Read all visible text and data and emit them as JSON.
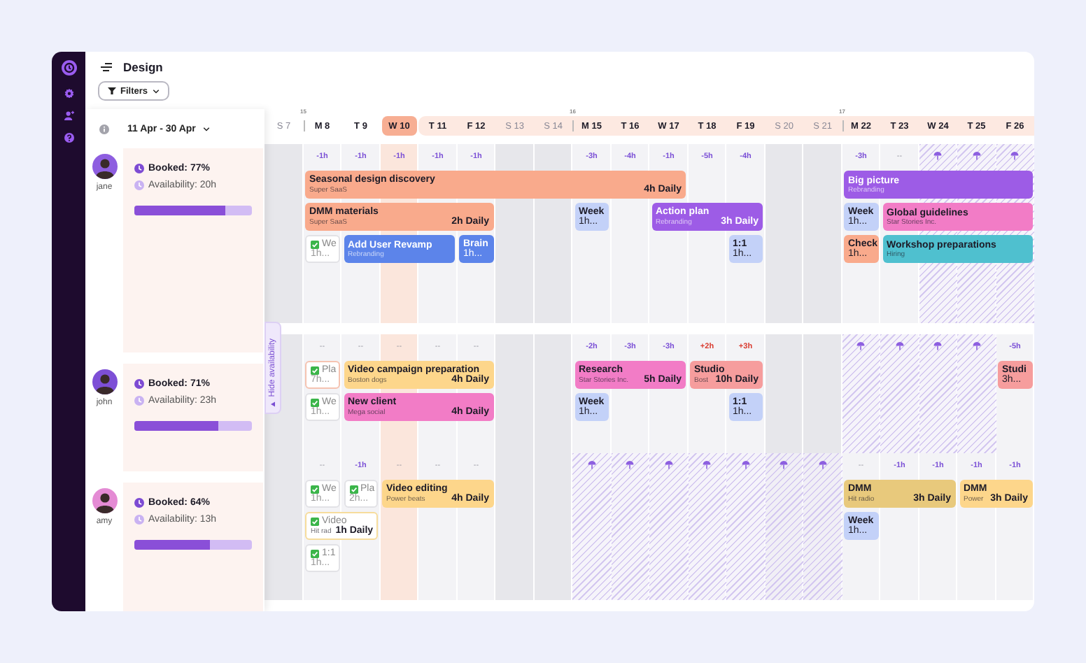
{
  "title": "Design",
  "filters": {
    "label": "Filters"
  },
  "date_range": "11 Apr - 30 Apr",
  "hide_availability": "Hide availability",
  "days": [
    {
      "label": "S 7",
      "weekend": true,
      "today": false,
      "in_range": false
    },
    {
      "label": "M 8",
      "weekend": false,
      "today": false,
      "in_range": false,
      "week": "15"
    },
    {
      "label": "T 9",
      "weekend": false,
      "today": false,
      "in_range": false
    },
    {
      "label": "W 10",
      "weekend": false,
      "today": true,
      "in_range": false
    },
    {
      "label": "T 11",
      "weekend": false,
      "today": false,
      "in_range": true
    },
    {
      "label": "F 12",
      "weekend": false,
      "today": false,
      "in_range": true
    },
    {
      "label": "S 13",
      "weekend": true,
      "today": false,
      "in_range": true
    },
    {
      "label": "S 14",
      "weekend": true,
      "today": false,
      "in_range": true
    },
    {
      "label": "M 15",
      "weekend": false,
      "today": false,
      "in_range": true,
      "week": "16"
    },
    {
      "label": "T 16",
      "weekend": false,
      "today": false,
      "in_range": true
    },
    {
      "label": "W 17",
      "weekend": false,
      "today": false,
      "in_range": true
    },
    {
      "label": "T 18",
      "weekend": false,
      "today": false,
      "in_range": true
    },
    {
      "label": "F 19",
      "weekend": false,
      "today": false,
      "in_range": true
    },
    {
      "label": "S 20",
      "weekend": true,
      "today": false,
      "in_range": true
    },
    {
      "label": "S 21",
      "weekend": true,
      "today": false,
      "in_range": true
    },
    {
      "label": "M 22",
      "weekend": false,
      "today": false,
      "in_range": true,
      "week": "17"
    },
    {
      "label": "T 23",
      "weekend": false,
      "today": false,
      "in_range": true
    },
    {
      "label": "W 24",
      "weekend": false,
      "today": false,
      "in_range": true
    },
    {
      "label": "T 25",
      "weekend": false,
      "today": false,
      "in_range": true
    },
    {
      "label": "F 26",
      "weekend": false,
      "today": false,
      "in_range": true
    }
  ],
  "people": [
    {
      "name": "jane",
      "booked": "Booked: 77%",
      "availability": "Availability: 20h",
      "level": 0.77,
      "cells": [
        {
          "kind": "blank"
        },
        {
          "kind": "under",
          "label": "-1h"
        },
        {
          "kind": "under",
          "label": "-1h"
        },
        {
          "kind": "under",
          "label": "-1h"
        },
        {
          "kind": "under",
          "label": "-1h"
        },
        {
          "kind": "under",
          "label": "-1h"
        },
        {
          "kind": "blank"
        },
        {
          "kind": "blank"
        },
        {
          "kind": "under",
          "label": "-3h"
        },
        {
          "kind": "under",
          "label": "-4h"
        },
        {
          "kind": "under",
          "label": "-1h"
        },
        {
          "kind": "under",
          "label": "-5h"
        },
        {
          "kind": "under",
          "label": "-4h"
        },
        {
          "kind": "blank"
        },
        {
          "kind": "blank"
        },
        {
          "kind": "under",
          "label": "-3h"
        },
        {
          "kind": "empty",
          "label": "--"
        },
        {
          "kind": "holiday"
        },
        {
          "kind": "holiday"
        },
        {
          "kind": "holiday"
        }
      ],
      "events": [
        {
          "kind": "event",
          "title": "Seasonal design discovery",
          "subtitle": "Super SaaS",
          "hours": "4h Daily",
          "color": "#f9aa8c"
        },
        {
          "kind": "event",
          "title": "Big picture",
          "subtitle": "Rebranding",
          "color": "#9d5ce6"
        },
        {
          "kind": "event",
          "title": "DMM materials",
          "subtitle": "Super SaaS",
          "hours": "2h Daily",
          "color": "#f9aa8c"
        },
        {
          "kind": "event",
          "title": "Week",
          "detail": "1h...",
          "color": "#c3d1f8"
        },
        {
          "kind": "event",
          "title": "Action plan",
          "subtitle": "Rebranding",
          "hours": "3h Daily",
          "color": "#9d5ce6"
        },
        {
          "kind": "event",
          "title": "Week",
          "detail": "1h...",
          "color": "#c3d1f8"
        },
        {
          "kind": "event",
          "title": "Global guidelines",
          "subtitle": "Star Stories Inc.",
          "color": "#f27cc6"
        },
        {
          "kind": "task",
          "title": "We",
          "detail": "1h...",
          "color": "#e2e2e6"
        },
        {
          "kind": "event",
          "title": "Add User Revamp",
          "subtitle": "Rebranding",
          "color": "#5c84ea"
        },
        {
          "kind": "event",
          "title": "Brain",
          "detail": "1h...",
          "color": "#5c84ea"
        },
        {
          "kind": "event",
          "title": "1:1",
          "detail": "1h...",
          "color": "#c3d1f8"
        },
        {
          "kind": "event",
          "title": "Check",
          "detail": "1h...",
          "color": "#f9aa8c"
        },
        {
          "kind": "event",
          "title": "Workshop preparations",
          "subtitle": "Hiring",
          "color": "#4fc0cf"
        }
      ]
    },
    {
      "name": "john",
      "booked": "Booked: 71%",
      "availability": "Availability: 23h",
      "level": 0.71,
      "cells": [
        {
          "kind": "blank"
        },
        {
          "kind": "empty",
          "label": "--"
        },
        {
          "kind": "empty",
          "label": "--"
        },
        {
          "kind": "empty",
          "label": "--"
        },
        {
          "kind": "empty",
          "label": "--"
        },
        {
          "kind": "empty",
          "label": "--"
        },
        {
          "kind": "blank"
        },
        {
          "kind": "blank"
        },
        {
          "kind": "under",
          "label": "-2h"
        },
        {
          "kind": "under",
          "label": "-3h"
        },
        {
          "kind": "under",
          "label": "-3h"
        },
        {
          "kind": "over",
          "label": "+2h"
        },
        {
          "kind": "over",
          "label": "+3h"
        },
        {
          "kind": "blank"
        },
        {
          "kind": "blank"
        },
        {
          "kind": "holiday"
        },
        {
          "kind": "holiday"
        },
        {
          "kind": "holiday"
        },
        {
          "kind": "holiday"
        },
        {
          "kind": "under",
          "label": "-5h"
        }
      ],
      "events": [
        {
          "kind": "task",
          "title": "Pla",
          "detail": "7h...",
          "color": "#f5c3b1"
        },
        {
          "kind": "event",
          "title": "Video campaign preparation",
          "subtitle": "Boston dogs",
          "hours": "4h Daily",
          "color": "#fdd68b"
        },
        {
          "kind": "event",
          "title": "Research",
          "subtitle": "Star Stories Inc.",
          "hours": "5h Daily",
          "color": "#f27cc6"
        },
        {
          "kind": "event",
          "title": "Studio",
          "subtitle": "Bost",
          "hours": "10h Daily",
          "color": "#f69d9d"
        },
        {
          "kind": "event",
          "title": "Studi",
          "detail": "3h...",
          "color": "#f69d9d"
        },
        {
          "kind": "task",
          "title": "We",
          "detail": "1h...",
          "color": "#e2e2e6"
        },
        {
          "kind": "event",
          "title": "New client",
          "subtitle": "Mega social",
          "hours": "4h Daily",
          "color": "#f27cc6"
        },
        {
          "kind": "event",
          "title": "Week",
          "detail": "1h...",
          "color": "#c3d1f8"
        },
        {
          "kind": "event",
          "title": "1:1",
          "detail": "1h...",
          "color": "#c3d1f8"
        }
      ]
    },
    {
      "name": "amy",
      "booked": "Booked: 64%",
      "availability": "Availability: 13h",
      "level": 0.64,
      "cells": [
        {
          "kind": "blank"
        },
        {
          "kind": "empty",
          "label": "--"
        },
        {
          "kind": "under",
          "label": "-1h"
        },
        {
          "kind": "empty",
          "label": "--"
        },
        {
          "kind": "empty",
          "label": "--"
        },
        {
          "kind": "empty",
          "label": "--"
        },
        {
          "kind": "blank"
        },
        {
          "kind": "blank"
        },
        {
          "kind": "holiday"
        },
        {
          "kind": "holiday"
        },
        {
          "kind": "holiday"
        },
        {
          "kind": "holiday"
        },
        {
          "kind": "holiday"
        },
        {
          "kind": "holiday"
        },
        {
          "kind": "holiday"
        },
        {
          "kind": "empty",
          "label": "--"
        },
        {
          "kind": "under",
          "label": "-1h"
        },
        {
          "kind": "under",
          "label": "-1h"
        },
        {
          "kind": "under",
          "label": "-1h"
        },
        {
          "kind": "under",
          "label": "-1h"
        }
      ],
      "events": [
        {
          "kind": "task",
          "title": "We",
          "detail": "1h...",
          "color": "#e2e2e6"
        },
        {
          "kind": "task",
          "title": "Pla",
          "detail": "2h...",
          "color": "#e2e2e6"
        },
        {
          "kind": "event",
          "title": "Video editing",
          "subtitle": "Power beats",
          "hours": "4h Daily",
          "color": "#fdd68b"
        },
        {
          "kind": "event",
          "title": "DMM",
          "subtitle": "Hit radio",
          "hours": "3h Daily",
          "color": "#e8c97c"
        },
        {
          "kind": "event",
          "title": "DMM",
          "subtitle": "Power",
          "hours": "3h Daily",
          "color": "#fdd68b"
        },
        {
          "kind": "task",
          "title": "Video",
          "subtitle": "Hit rad",
          "hours": "1h Daily",
          "color": "#f6dc9c"
        },
        {
          "kind": "event",
          "title": "Week",
          "detail": "1h...",
          "color": "#c3d1f8"
        },
        {
          "kind": "task",
          "title": "1:1",
          "detail": "1h...",
          "color": "#e2e2e6"
        }
      ]
    }
  ]
}
